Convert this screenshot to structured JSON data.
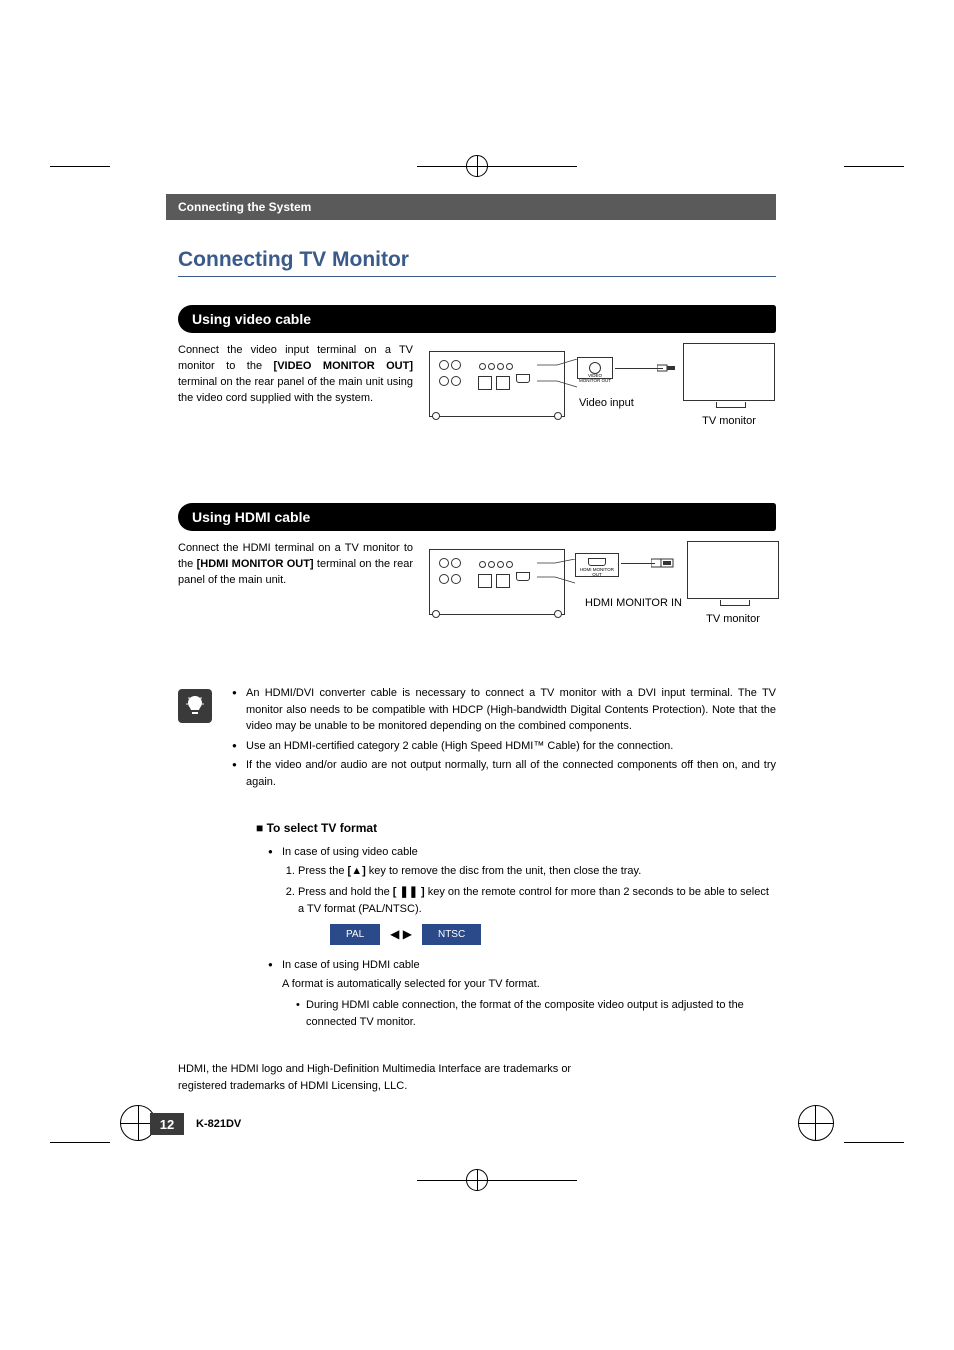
{
  "header": "Connecting the System",
  "title": "Connecting TV Monitor",
  "sectionA": {
    "bar": "Using video cable",
    "body_pre": "Connect the video input terminal on a TV monitor to the ",
    "body_bold": "[VIDEO MONITOR OUT]",
    "body_post": " terminal on the rear panel of the main unit using the video cord supplied with the system.",
    "port_label": "VIDEO MONITOR OUT",
    "cable_label": "Video input",
    "tv_label": "TV monitor"
  },
  "sectionB": {
    "bar": "Using HDMI cable",
    "body_pre": "Connect the HDMI terminal on a TV monitor to the ",
    "body_bold": "[HDMI MONITOR OUT]",
    "body_post": " terminal on the rear panel of the main unit.",
    "port_label": "HDMI MONITOR OUT",
    "cable_label": "HDMI MONITOR IN",
    "tv_label": "TV monitor"
  },
  "notes": [
    "An HDMI/DVI converter cable is necessary to connect  a TV monitor with a DVI input terminal. The TV monitor also needs to be compatible with HDCP (High-bandwidth Digital Contents Protection). Note that the video may be unable to be monitored depending on the combined components.",
    "Use an HDMI-certified category 2 cable (High Speed HDMI™ Cable) for the connection.",
    "If the video and/or audio are not output normally, turn all of the connected components off then on, and try again."
  ],
  "tvformat": {
    "title": "To select TV format",
    "caseA": {
      "head": "In case of using video cable",
      "step1_pre": "Press the ",
      "step1_icon": "[▲]",
      "step1_post": " key to remove the disc from the unit, then close the tray.",
      "step2_pre": "Press and hold the ",
      "step2_icon": "[ ❚❚ ]",
      "step2_post": " key on the remote control for more than 2 seconds to be able to select a TV format (PAL/NTSC).",
      "pal": "PAL",
      "ntsc": "NTSC",
      "arrows": "◀ ▶"
    },
    "caseB": {
      "head": "In case of using HDMI cable",
      "line1": "A format is automatically selected for your TV format.",
      "line2": "During HDMI cable connection, the format of the composite video output is adjusted to the connected TV monitor."
    }
  },
  "trademark": "HDMI, the HDMI logo and High-Definition Multimedia Interface are trademarks or registered trademarks of HDMI Licensing, LLC.",
  "page_num": "12",
  "model": "K-821DV"
}
